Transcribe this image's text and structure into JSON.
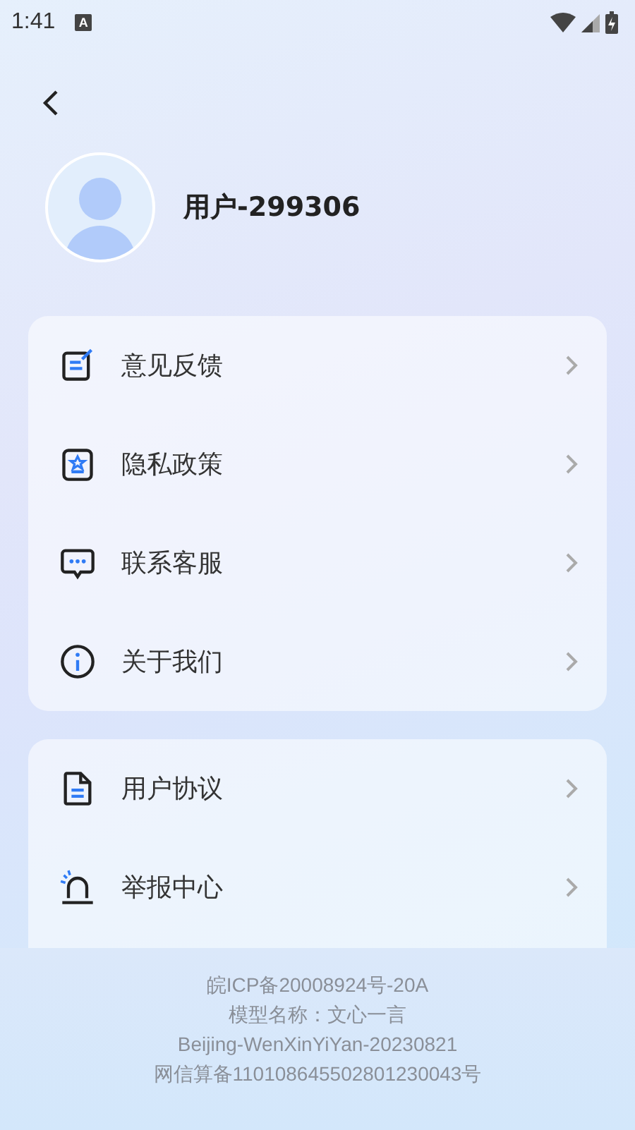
{
  "status_bar": {
    "time": "1:41",
    "notification": "A"
  },
  "profile": {
    "username": "用户-299306"
  },
  "menu_groups": [
    {
      "items": [
        {
          "label": "意见反馈",
          "kind": "feedback"
        },
        {
          "label": "隐私政策",
          "kind": "privacy"
        },
        {
          "label": "联系客服",
          "kind": "chat"
        },
        {
          "label": "关于我们",
          "kind": "info"
        }
      ]
    },
    {
      "items": [
        {
          "label": "用户协议",
          "kind": "document"
        },
        {
          "label": "举报中心",
          "kind": "alarm"
        }
      ]
    }
  ],
  "footer": [
    "皖ICP备20008924号-20A",
    "模型名称：文心一言",
    "Beijing-WenXinYiYan-20230821",
    "网信算备110108645502801230043号"
  ]
}
